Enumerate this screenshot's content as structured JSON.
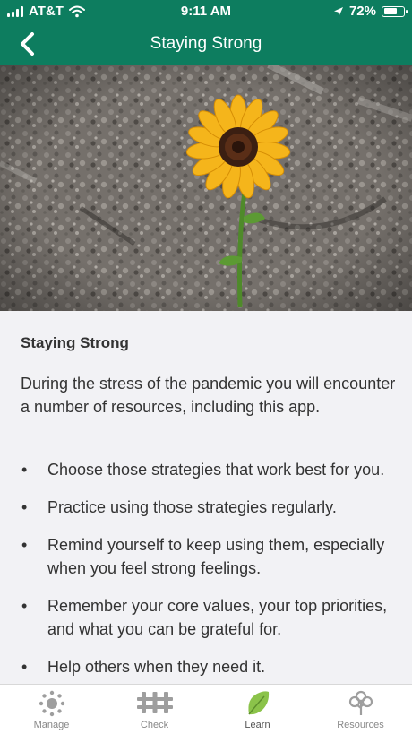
{
  "status": {
    "carrier": "AT&T",
    "time": "9:11 AM",
    "battery": "72%",
    "battery_level": 0.72
  },
  "nav": {
    "title": "Staying Strong",
    "back_icon": "chevron-left-icon"
  },
  "hero": {
    "image": "sunflower-growing-in-gravel"
  },
  "article": {
    "heading": "Staying Strong",
    "intro": "During the stress of the pandemic you will encounter a number of resources, including this app.",
    "bullet_mark": "•",
    "bullets": [
      "Choose those strategies that work best for you.",
      "Practice using those strategies regularly.",
      "Remind yourself to keep using them, especially when you feel strong feelings.",
      "Remember your core values, your top priorities, and what you can be grateful for.",
      "Help others when they need it."
    ]
  },
  "tabs": [
    {
      "label": "Manage",
      "icon": "sun-icon",
      "active": false
    },
    {
      "label": "Check",
      "icon": "fence-icon",
      "active": false
    },
    {
      "label": "Learn",
      "icon": "leaf-icon",
      "active": true
    },
    {
      "label": "Resources",
      "icon": "tree-icon",
      "active": false
    }
  ],
  "colors": {
    "brand": "#0d7d5f",
    "active_tab": "#8bc34a",
    "inactive_tab": "#9e9e9e",
    "content_bg": "#f2f2f5"
  }
}
